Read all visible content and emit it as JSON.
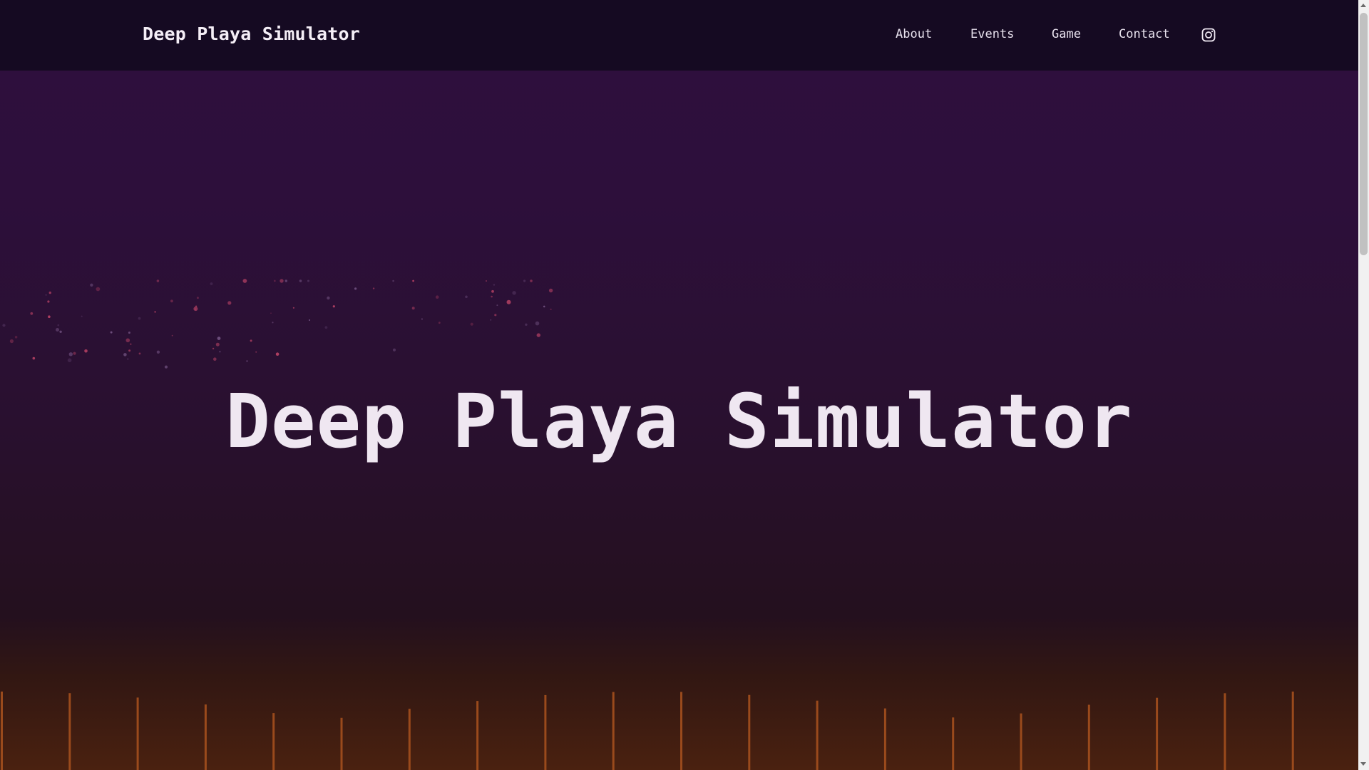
{
  "brand": "Deep Playa Simulator",
  "nav": {
    "items": [
      {
        "label": "About"
      },
      {
        "label": "Events"
      },
      {
        "label": "Game"
      },
      {
        "label": "Contact"
      }
    ],
    "social_icon": "instagram-icon"
  },
  "hero": {
    "title": "Deep Playa Simulator"
  },
  "colors": {
    "nav_bg": "#150a22",
    "hero_top": "#2e0f3e",
    "hero_bottom": "#4a2110",
    "text": "#efe7f1",
    "bars": "#9a4a1c",
    "sparkles": "#c8486a"
  }
}
